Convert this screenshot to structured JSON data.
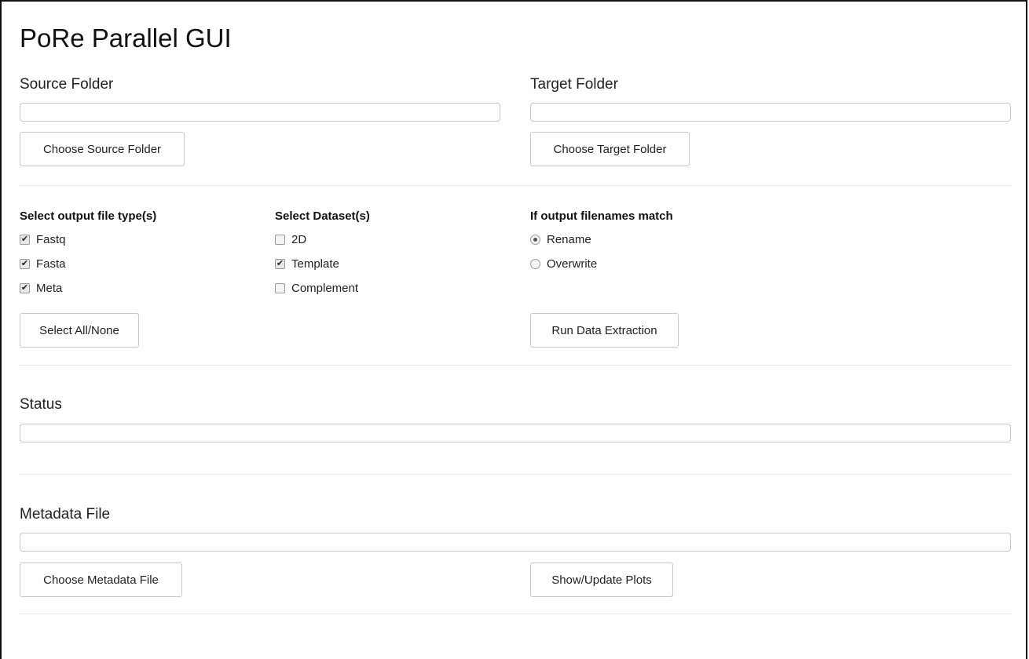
{
  "app": {
    "title": "PoRe Parallel GUI"
  },
  "source": {
    "heading": "Source Folder",
    "value": "",
    "button_label": "Choose Source Folder"
  },
  "target": {
    "heading": "Target Folder",
    "value": "",
    "button_label": "Choose Target Folder"
  },
  "file_types": {
    "label": "Select output file type(s)",
    "options": [
      {
        "label": "Fastq",
        "checked": true
      },
      {
        "label": "Fasta",
        "checked": true
      },
      {
        "label": "Meta",
        "checked": true
      }
    ],
    "button_label": "Select All/None"
  },
  "datasets": {
    "label": "Select Dataset(s)",
    "options": [
      {
        "label": "2D",
        "checked": false
      },
      {
        "label": "Template",
        "checked": true
      },
      {
        "label": "Complement",
        "checked": false
      }
    ]
  },
  "filename_match": {
    "label": "If output filenames match",
    "options": [
      {
        "label": "Rename",
        "selected": true
      },
      {
        "label": "Overwrite",
        "selected": false
      }
    ],
    "button_label": "Run Data Extraction"
  },
  "status": {
    "heading": "Status",
    "value": ""
  },
  "metadata": {
    "heading": "Metadata File",
    "value": "",
    "button_label": "Choose Metadata File",
    "plots_button_label": "Show/Update Plots"
  }
}
